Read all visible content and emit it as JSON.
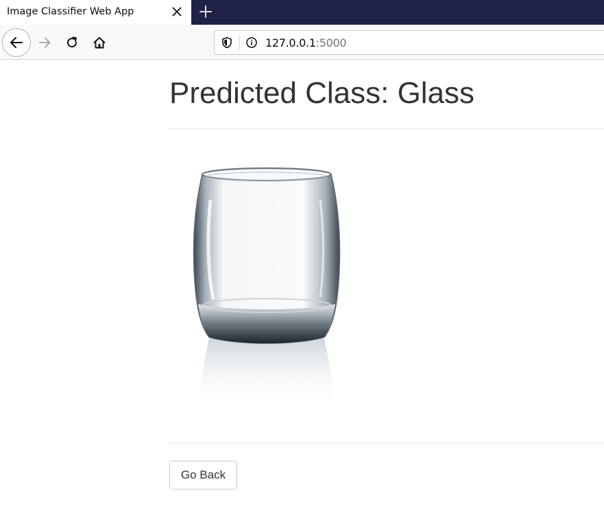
{
  "browser": {
    "tab_title": "Image Classifier Web App",
    "url_host": "127.0.0.1",
    "url_port": ":5000",
    "tabstrip_color": "#1f2146",
    "icons": {
      "tab_close": "close-icon",
      "new_tab": "plus-icon",
      "back": "arrow-left-icon",
      "forward": "arrow-right-icon",
      "reload": "reload-icon",
      "home": "home-icon",
      "tracking": "shield-icon",
      "site_info": "info-icon"
    }
  },
  "page": {
    "heading": "Predicted Class: Glass",
    "image_subject": "drinking glass",
    "go_back_label": "Go Back"
  }
}
